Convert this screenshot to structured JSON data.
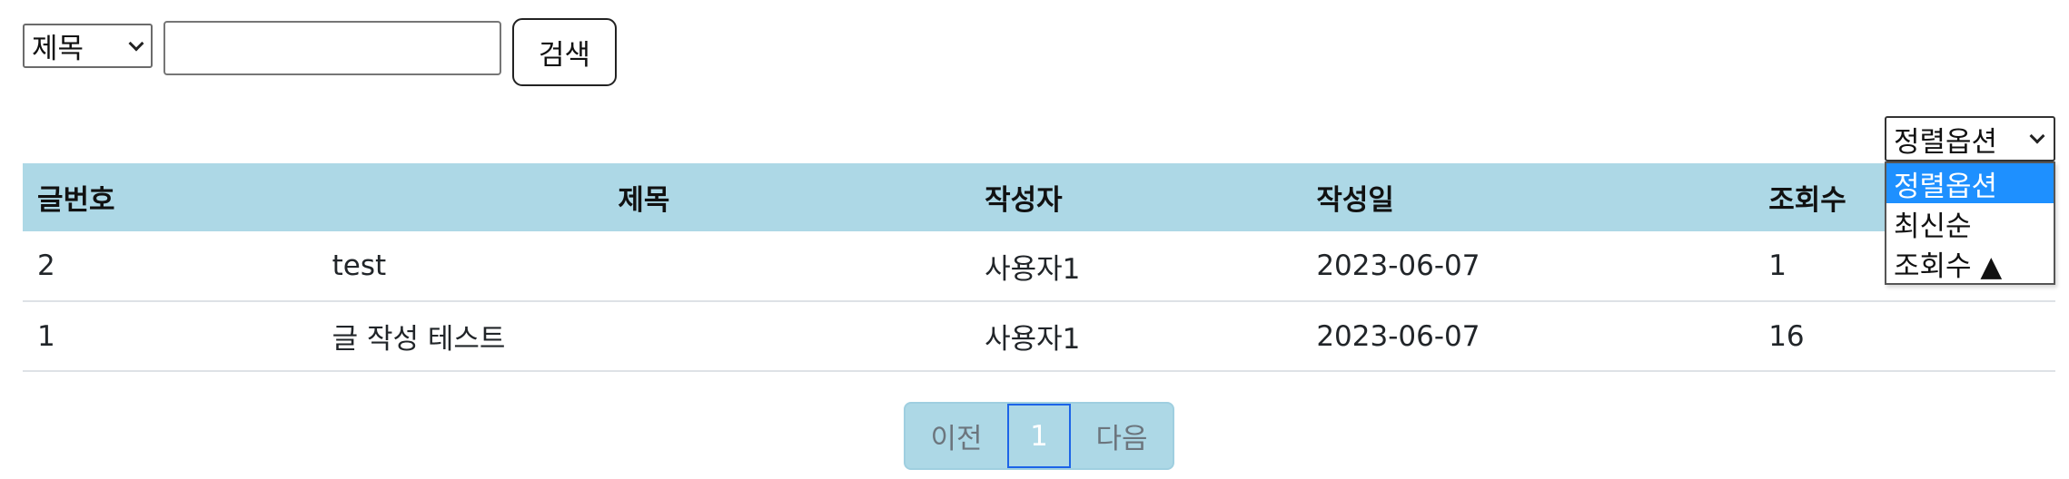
{
  "search": {
    "field_select": {
      "selected": "제목"
    },
    "query_value": "",
    "button_label": "검색"
  },
  "sort": {
    "selected": "정렬옵션",
    "options": [
      "정렬옵션",
      "최신순",
      "조회수 ▲"
    ],
    "highlighted_index": 0
  },
  "table": {
    "headers": [
      "글번호",
      "제목",
      "작성자",
      "작성일",
      "조회수"
    ],
    "rows": [
      {
        "no": "2",
        "title": "test",
        "author": "사용자1",
        "date": "2023-06-07",
        "views": "1"
      },
      {
        "no": "1",
        "title": "글 작성 테스트",
        "author": "사용자1",
        "date": "2023-06-07",
        "views": "16"
      }
    ]
  },
  "pagination": {
    "prev_label": "이전",
    "current_page": "1",
    "next_label": "다음"
  },
  "colors": {
    "header_bg": "#add8e6",
    "option_highlight": "#1e90ff",
    "active_page_border": "#1c64e8"
  }
}
